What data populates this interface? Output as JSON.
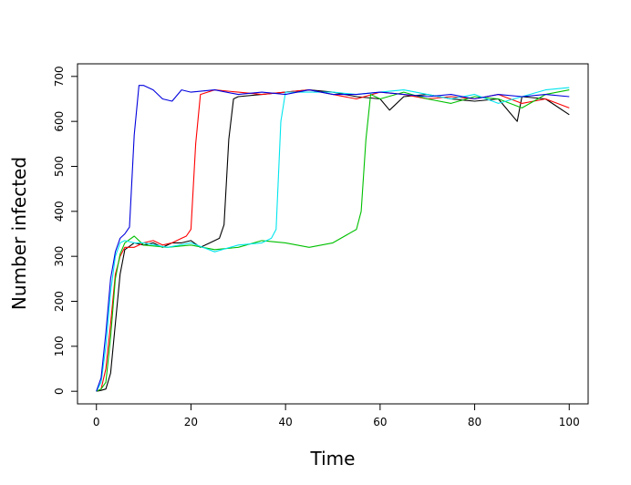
{
  "chart_data": {
    "type": "line",
    "title": "",
    "xlabel": "Time",
    "ylabel": "Number infected",
    "xlim": [
      -4,
      104
    ],
    "ylim": [
      -28,
      728
    ],
    "grid": false,
    "legend": "none",
    "xticks": [
      0,
      20,
      40,
      60,
      80,
      100
    ],
    "yticks": [
      0,
      100,
      200,
      300,
      400,
      500,
      600,
      700
    ],
    "x_tick_labels": [
      "0",
      "20",
      "40",
      "60",
      "80",
      "100"
    ],
    "y_tick_labels": [
      "0",
      "100",
      "200",
      "300",
      "400",
      "500",
      "600",
      "700"
    ],
    "series": [
      {
        "color": "#000000",
        "x": [
          0,
          1,
          2,
          3,
          4,
          5,
          6,
          8,
          10,
          12,
          14,
          16,
          18,
          20,
          22,
          24,
          26,
          27,
          28,
          29,
          30,
          35,
          40,
          45,
          50,
          55,
          60,
          62,
          65,
          70,
          75,
          80,
          85,
          89,
          90,
          95,
          100
        ],
        "y": [
          0,
          2,
          5,
          40,
          150,
          260,
          315,
          330,
          325,
          330,
          320,
          330,
          330,
          335,
          320,
          330,
          340,
          370,
          560,
          650,
          655,
          660,
          665,
          670,
          665,
          655,
          650,
          625,
          655,
          660,
          650,
          645,
          650,
          600,
          655,
          650,
          615
        ]
      },
      {
        "color": "#ff0000",
        "x": [
          0,
          1,
          2,
          3,
          4,
          5,
          6,
          8,
          10,
          12,
          14,
          16,
          18,
          19,
          20,
          21,
          22,
          25,
          30,
          35,
          40,
          45,
          50,
          55,
          60,
          65,
          70,
          75,
          80,
          85,
          90,
          95,
          100
        ],
        "y": [
          0,
          5,
          50,
          150,
          260,
          300,
          320,
          320,
          330,
          335,
          325,
          330,
          340,
          345,
          360,
          550,
          660,
          670,
          665,
          660,
          665,
          670,
          660,
          650,
          665,
          660,
          650,
          655,
          650,
          660,
          640,
          650,
          630
        ]
      },
      {
        "color": "#00c000",
        "x": [
          0,
          1,
          2,
          3,
          4,
          5,
          6,
          8,
          10,
          15,
          20,
          25,
          30,
          35,
          40,
          45,
          50,
          55,
          56,
          57,
          58,
          60,
          65,
          70,
          75,
          80,
          85,
          90,
          95,
          100
        ],
        "y": [
          0,
          5,
          20,
          120,
          250,
          305,
          330,
          345,
          325,
          320,
          325,
          315,
          320,
          335,
          330,
          320,
          330,
          360,
          400,
          560,
          660,
          650,
          665,
          650,
          640,
          655,
          650,
          630,
          660,
          670
        ]
      },
      {
        "color": "#00e5ee",
        "x": [
          0,
          1,
          2,
          3,
          4,
          5,
          6,
          8,
          10,
          15,
          20,
          25,
          30,
          35,
          37,
          38,
          39,
          40,
          45,
          50,
          55,
          60,
          65,
          70,
          75,
          80,
          85,
          90,
          95,
          100
        ],
        "y": [
          0,
          20,
          100,
          220,
          300,
          330,
          335,
          330,
          330,
          320,
          330,
          310,
          325,
          330,
          340,
          360,
          600,
          665,
          665,
          665,
          660,
          665,
          670,
          660,
          650,
          660,
          640,
          655,
          670,
          675
        ]
      },
      {
        "color": "#0000dd",
        "x": [
          0,
          1,
          2,
          3,
          4,
          5,
          6,
          7,
          8,
          9,
          10,
          12,
          14,
          16,
          18,
          20,
          25,
          30,
          35,
          40,
          45,
          50,
          55,
          60,
          65,
          70,
          75,
          80,
          85,
          90,
          95,
          100
        ],
        "y": [
          0,
          30,
          130,
          250,
          310,
          340,
          350,
          365,
          570,
          680,
          680,
          670,
          650,
          645,
          670,
          665,
          670,
          660,
          665,
          660,
          670,
          660,
          660,
          665,
          660,
          655,
          660,
          650,
          660,
          655,
          660,
          655
        ]
      }
    ]
  }
}
